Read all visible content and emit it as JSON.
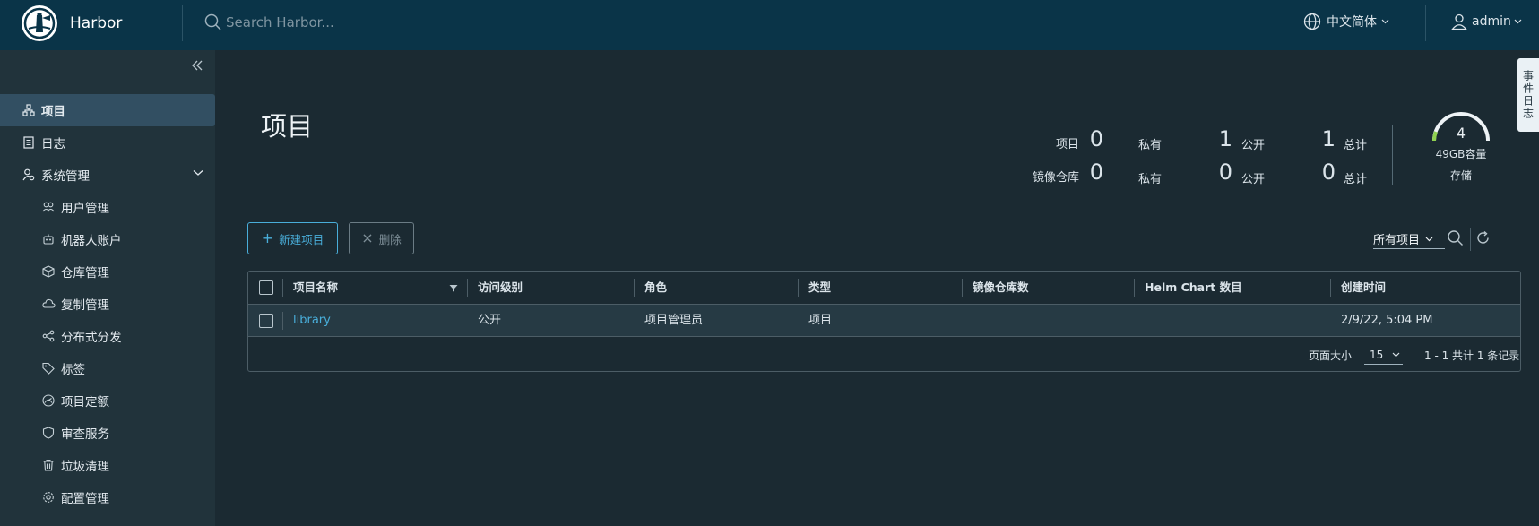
{
  "header": {
    "brand": "Harbor",
    "search_placeholder": "Search Harbor...",
    "language": "中文简体",
    "user": "admin"
  },
  "sidebar": {
    "items": [
      {
        "label": "项目",
        "icon": "project-icon",
        "active": true
      },
      {
        "label": "日志",
        "icon": "log-icon"
      },
      {
        "label": "系统管理",
        "icon": "admin-icon"
      },
      {
        "label": "用户管理",
        "icon": "users-icon"
      },
      {
        "label": "机器人账户",
        "icon": "robot-icon"
      },
      {
        "label": "仓库管理",
        "icon": "box-icon"
      },
      {
        "label": "复制管理",
        "icon": "cloud-icon"
      },
      {
        "label": "分布式分发",
        "icon": "share-icon"
      },
      {
        "label": "标签",
        "icon": "tag-icon"
      },
      {
        "label": "项目定额",
        "icon": "quota-icon"
      },
      {
        "label": "审查服务",
        "icon": "shield-icon"
      },
      {
        "label": "垃圾清理",
        "icon": "trash-icon"
      },
      {
        "label": "配置管理",
        "icon": "gear-icon"
      }
    ]
  },
  "main": {
    "title": "项目",
    "stats": {
      "project_label": "项目",
      "repo_label": "镜像仓库",
      "private_label": "私有",
      "public_label": "公开",
      "total_label": "总计",
      "project_private": "0",
      "project_public": "1",
      "project_total": "1",
      "repo_private": "0",
      "repo_public": "0",
      "repo_total": "0"
    },
    "storage": {
      "count": "4",
      "capacity": "49GB容量",
      "label": "存储"
    },
    "buttons": {
      "new_project": "新建项目",
      "delete": "删除"
    },
    "filter": "所有项目",
    "table": {
      "columns": [
        "项目名称",
        "访问级别",
        "角色",
        "类型",
        "镜像仓库数",
        "Helm Chart 数目",
        "创建时间"
      ],
      "rows": [
        [
          "library",
          "公开",
          "项目管理员",
          "项目",
          "",
          "",
          "2/9/22, 5:04 PM"
        ]
      ],
      "page_size_label": "页面大小",
      "page_size": "15",
      "page_info": "1 - 1 共计 1 条记录"
    },
    "side_tab": "事件日志"
  },
  "colors": {
    "header_bg": "#0a3448",
    "sidebar_bg": "#21333b",
    "content_bg": "#1b2a32",
    "accent": "#49aeda",
    "active_nav": "#324f62"
  }
}
